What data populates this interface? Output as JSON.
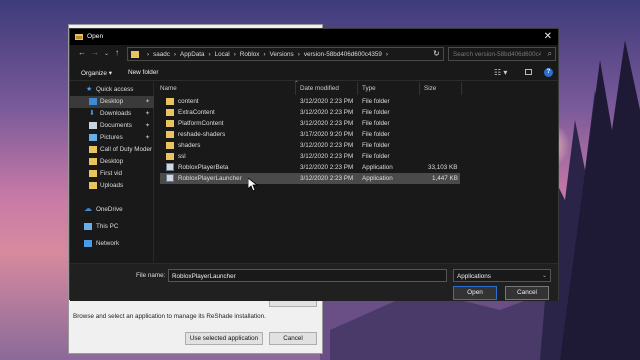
{
  "installer": {
    "description": "Browse and select an application to manage its ReShade installation.",
    "use_selected_label": "Use selected application",
    "cancel_label": "Cancel"
  },
  "dialog": {
    "title": "Open",
    "breadcrumb": [
      "saadc",
      "AppData",
      "Local",
      "Roblox",
      "Versions",
      "version-58bd406d600c4359"
    ],
    "search_placeholder": "Search version-58bd406d600c4...",
    "organize_label": "Organize ▾",
    "new_folder_label": "New folder",
    "columns": {
      "name": "Name",
      "date": "Date modified",
      "type": "Type",
      "size": "Size"
    },
    "nav": [
      {
        "label": "Quick access",
        "icon": "star-icon"
      },
      {
        "label": "Desktop",
        "icon": "desktop-icon"
      },
      {
        "label": "Downloads",
        "icon": "download-icon"
      },
      {
        "label": "Documents",
        "icon": "documents-icon"
      },
      {
        "label": "Pictures",
        "icon": "pictures-icon"
      },
      {
        "label": "Call of Duty Moder",
        "icon": "folder-icon"
      },
      {
        "label": "Desktop",
        "icon": "folder-icon"
      },
      {
        "label": "First vid",
        "icon": "folder-icon"
      },
      {
        "label": "Uploads",
        "icon": "folder-icon"
      },
      {
        "label": "OneDrive",
        "icon": "cloud-icon"
      },
      {
        "label": "This PC",
        "icon": "computer-icon"
      },
      {
        "label": "Network",
        "icon": "network-icon"
      }
    ],
    "files": [
      {
        "name": "content",
        "date": "3/12/2020 2:23 PM",
        "type": "File folder",
        "size": "",
        "kind": "folder"
      },
      {
        "name": "ExtraContent",
        "date": "3/12/2020 2:23 PM",
        "type": "File folder",
        "size": "",
        "kind": "folder"
      },
      {
        "name": "PlatformContent",
        "date": "3/12/2020 2:23 PM",
        "type": "File folder",
        "size": "",
        "kind": "folder"
      },
      {
        "name": "reshade-shaders",
        "date": "3/17/2020 9:20 PM",
        "type": "File folder",
        "size": "",
        "kind": "folder"
      },
      {
        "name": "shaders",
        "date": "3/12/2020 2:23 PM",
        "type": "File folder",
        "size": "",
        "kind": "folder"
      },
      {
        "name": "ssl",
        "date": "3/12/2020 2:23 PM",
        "type": "File folder",
        "size": "",
        "kind": "folder"
      },
      {
        "name": "RobloxPlayerBeta",
        "date": "3/12/2020 2:23 PM",
        "type": "Application",
        "size": "33,103 KB",
        "kind": "app"
      },
      {
        "name": "RobloxPlayerLauncher",
        "date": "3/12/2020 2:23 PM",
        "type": "Application",
        "size": "1,447 KB",
        "kind": "app"
      }
    ],
    "file_name_label": "File name:",
    "file_name_value": "RobloxPlayerLauncher",
    "file_type": "Applications",
    "open_label": "Open",
    "cancel_label": "Cancel"
  }
}
